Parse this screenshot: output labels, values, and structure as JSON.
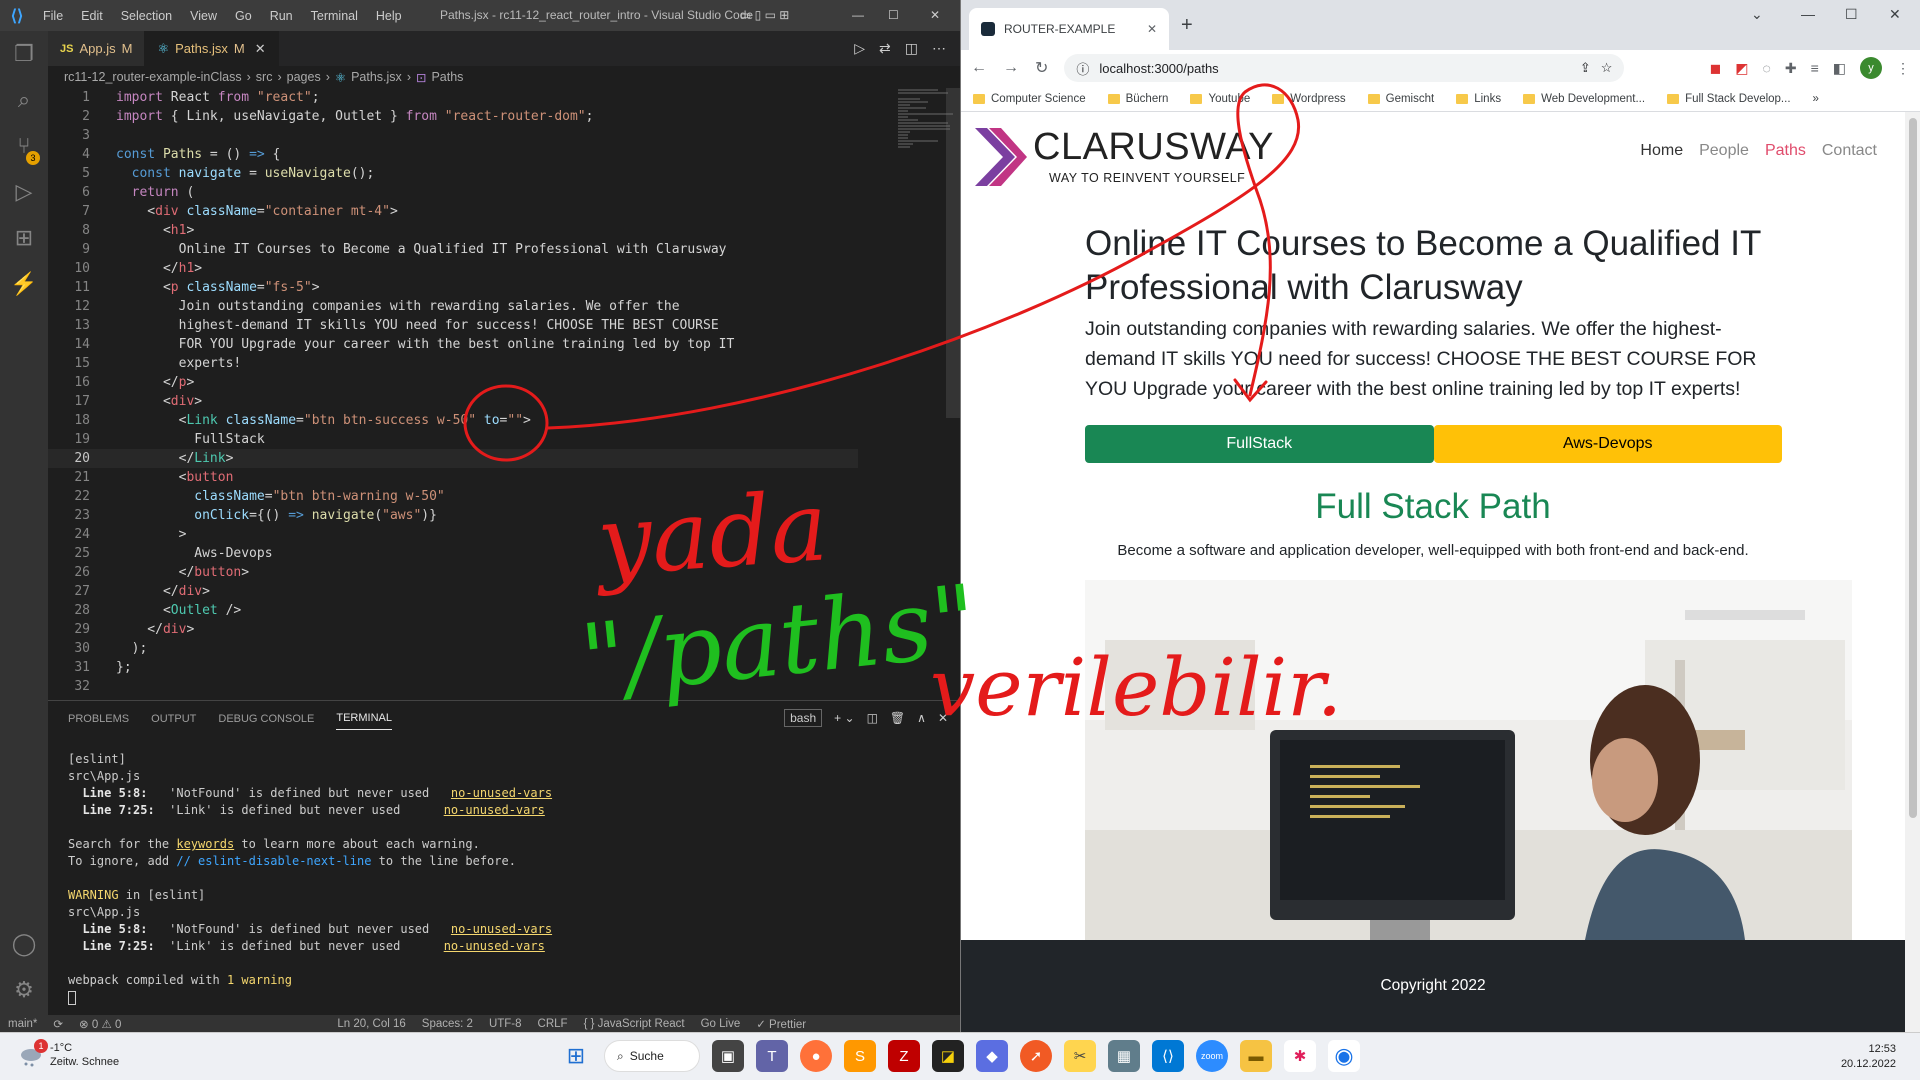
{
  "vscode": {
    "menu": [
      "File",
      "Edit",
      "Selection",
      "View",
      "Go",
      "Run",
      "Terminal",
      "Help"
    ],
    "window_title": "Paths.jsx - rc11-12_react_router_intro - Visual Studio Code",
    "tabs": [
      {
        "badge": "JS",
        "name": "App.js",
        "status": "M"
      },
      {
        "badge": "⚛",
        "name": "Paths.jsx",
        "status": "M"
      }
    ],
    "breadcrumb": [
      "rc11-12_router-example-inClass",
      "src",
      "pages",
      "Paths.jsx",
      "Paths"
    ],
    "panel_tabs": [
      "PROBLEMS",
      "OUTPUT",
      "DEBUG CONSOLE",
      "TERMINAL"
    ],
    "shell": "bash",
    "terminal": {
      "l1": "[eslint]",
      "l2": "src\\App.js",
      "w1_loc": "  Line 5:8:",
      "w1_msg": "   'NotFound' is defined but never used   ",
      "rule": "no-unused-vars",
      "w2_loc": "  Line 7:25:",
      "w2_msg": "  'Link' is defined but never used      ",
      "search_a": "Search for the ",
      "keywords": "keywords",
      "search_b": " to learn more about each warning.",
      "ignore_a": "To ignore, add ",
      "ignore_code": "// eslint-disable-next-line",
      "ignore_b": " to the line before.",
      "warning": "WARNING",
      "warning_rest": " in [eslint]",
      "compiled_a": "webpack compiled with ",
      "compiled_n": "1 warning"
    },
    "status": {
      "branch": "main*",
      "problems": "⊗ 0 ⚠ 0",
      "position": "Ln 20, Col 16",
      "spaces": "Spaces: 2",
      "encoding": "UTF-8",
      "eol": "CRLF",
      "language": "{ } JavaScript React",
      "golive": "Go Live",
      "prettier": "✓ Prettier"
    }
  },
  "code": [
    {
      "n": 1,
      "t": [
        [
          "kw",
          "import "
        ],
        [
          "pun",
          "React "
        ],
        [
          "kw",
          "from "
        ],
        [
          "str",
          "\"react\""
        ],
        [
          "pun",
          ";"
        ]
      ]
    },
    {
      "n": 2,
      "t": [
        [
          "kw",
          "import "
        ],
        [
          "pun",
          "{ Link, useNavigate, Outlet } "
        ],
        [
          "kw",
          "from "
        ],
        [
          "str",
          "\"react-router-dom\""
        ],
        [
          "pun",
          ";"
        ]
      ]
    },
    {
      "n": 3,
      "t": []
    },
    {
      "n": 4,
      "t": [
        [
          "kw2",
          "const "
        ],
        [
          "fn",
          "Paths"
        ],
        [
          "pun",
          " = () "
        ],
        [
          "kw2",
          "=>"
        ],
        [
          "pun",
          " {"
        ]
      ]
    },
    {
      "n": 5,
      "t": [
        [
          "pun",
          "  "
        ],
        [
          "kw2",
          "const "
        ],
        [
          "var",
          "navigate"
        ],
        [
          "pun",
          " = "
        ],
        [
          "fn",
          "useNavigate"
        ],
        [
          "pun",
          "();"
        ]
      ]
    },
    {
      "n": 6,
      "t": [
        [
          "pun",
          "  "
        ],
        [
          "kw",
          "return"
        ],
        [
          "pun",
          " ("
        ]
      ]
    },
    {
      "n": 7,
      "t": [
        [
          "pun",
          "    <"
        ],
        [
          "tagc",
          "div "
        ],
        [
          "attr",
          "className"
        ],
        [
          "pun",
          "="
        ],
        [
          "str",
          "\"container mt-4\""
        ],
        [
          "pun",
          ">"
        ]
      ]
    },
    {
      "n": 8,
      "t": [
        [
          "pun",
          "      <"
        ],
        [
          "tagc",
          "h1"
        ],
        [
          "pun",
          ">"
        ]
      ]
    },
    {
      "n": 9,
      "t": [
        [
          "pun",
          "        Online IT Courses to Become a Qualified IT Professional with Clarusway"
        ]
      ]
    },
    {
      "n": 10,
      "t": [
        [
          "pun",
          "      </"
        ],
        [
          "tagc",
          "h1"
        ],
        [
          "pun",
          ">"
        ]
      ]
    },
    {
      "n": 11,
      "t": [
        [
          "pun",
          "      <"
        ],
        [
          "tagc",
          "p "
        ],
        [
          "attr",
          "className"
        ],
        [
          "pun",
          "="
        ],
        [
          "str",
          "\"fs-5\""
        ],
        [
          "pun",
          ">"
        ]
      ]
    },
    {
      "n": 12,
      "t": [
        [
          "pun",
          "        Join outstanding companies with rewarding salaries. We offer the"
        ]
      ]
    },
    {
      "n": 13,
      "t": [
        [
          "pun",
          "        highest-demand IT skills YOU need for success! CHOOSE THE BEST COURSE"
        ]
      ]
    },
    {
      "n": 14,
      "t": [
        [
          "pun",
          "        FOR YOU Upgrade your career with the best online training led by top IT"
        ]
      ]
    },
    {
      "n": 15,
      "t": [
        [
          "pun",
          "        experts!"
        ]
      ]
    },
    {
      "n": 16,
      "t": [
        [
          "pun",
          "      </"
        ],
        [
          "tagc",
          "p"
        ],
        [
          "pun",
          ">"
        ]
      ]
    },
    {
      "n": 17,
      "t": [
        [
          "pun",
          "      <"
        ],
        [
          "tagc",
          "div"
        ],
        [
          "pun",
          ">"
        ]
      ]
    },
    {
      "n": 18,
      "t": [
        [
          "pun",
          "        <"
        ],
        [
          "cmp",
          "Link "
        ],
        [
          "attr",
          "className"
        ],
        [
          "pun",
          "="
        ],
        [
          "str",
          "\"btn btn-success w-50\" "
        ],
        [
          "attr",
          "to"
        ],
        [
          "pun",
          "="
        ],
        [
          "str",
          "\"\""
        ],
        [
          "pun",
          ">"
        ]
      ]
    },
    {
      "n": 19,
      "t": [
        [
          "pun",
          "          FullStack"
        ]
      ]
    },
    {
      "n": 20,
      "t": [
        [
          "pun",
          "        </"
        ],
        [
          "cmp",
          "Link"
        ],
        [
          "pun",
          ">"
        ]
      ]
    },
    {
      "n": 21,
      "t": [
        [
          "pun",
          "        <"
        ],
        [
          "tagc",
          "button"
        ]
      ]
    },
    {
      "n": 22,
      "t": [
        [
          "pun",
          "          "
        ],
        [
          "attr",
          "className"
        ],
        [
          "pun",
          "="
        ],
        [
          "str",
          "\"btn btn-warning w-50\""
        ]
      ]
    },
    {
      "n": 23,
      "t": [
        [
          "pun",
          "          "
        ],
        [
          "attr",
          "onClick"
        ],
        [
          "pun",
          "={() "
        ],
        [
          "kw2",
          "=>"
        ],
        [
          "pun",
          " "
        ],
        [
          "fn",
          "navigate"
        ],
        [
          "pun",
          "("
        ],
        [
          "str",
          "\"aws\""
        ],
        [
          "pun",
          ")}"
        ]
      ]
    },
    {
      "n": 24,
      "t": [
        [
          "pun",
          "        >"
        ]
      ]
    },
    {
      "n": 25,
      "t": [
        [
          "pun",
          "          Aws-Devops"
        ]
      ]
    },
    {
      "n": 26,
      "t": [
        [
          "pun",
          "        </"
        ],
        [
          "tagc",
          "button"
        ],
        [
          "pun",
          ">"
        ]
      ]
    },
    {
      "n": 27,
      "t": [
        [
          "pun",
          "      </"
        ],
        [
          "tagc",
          "div"
        ],
        [
          "pun",
          ">"
        ]
      ]
    },
    {
      "n": 28,
      "t": [
        [
          "pun",
          "      <"
        ],
        [
          "cmp",
          "Outlet "
        ],
        [
          "pun",
          "/>"
        ]
      ]
    },
    {
      "n": 29,
      "t": [
        [
          "pun",
          "    </"
        ],
        [
          "tagc",
          "div"
        ],
        [
          "pun",
          ">"
        ]
      ]
    },
    {
      "n": 30,
      "t": [
        [
          "pun",
          "  );"
        ]
      ]
    },
    {
      "n": 31,
      "t": [
        [
          "pun",
          "};"
        ]
      ]
    },
    {
      "n": 32,
      "t": []
    }
  ],
  "browser": {
    "tab_title": "ROUTER-EXAMPLE",
    "url": "localhost:3000/paths",
    "bookmarks": [
      "Computer Science",
      "Büchern",
      "Youtube",
      "Wordpress",
      "Gemischt",
      "Links",
      "Web Development...",
      "Full Stack Develop..."
    ],
    "avatar": "y"
  },
  "site": {
    "brand": "CLARUSWAY",
    "tagline": "WAY TO REINVENT YOURSELF",
    "nav": [
      "Home",
      "People",
      "Paths",
      "Contact"
    ],
    "h1": "Online IT Courses to Become a Qualified IT Professional with Clarusway",
    "lead": "Join outstanding companies with rewarding salaries. We offer the highest-demand IT skills YOU need for success! CHOOSE THE BEST COURSE FOR YOU Upgrade your career with the best online training led by top IT experts!",
    "btn_fullstack": "FullStack",
    "btn_aws": "Aws-Devops",
    "path_title": "Full Stack Path",
    "path_desc": "Become a software and application developer, well-equipped with both front-end and back-end.",
    "footer": "Copyright 2022"
  },
  "annotation": {
    "word1": "yada",
    "word2": "\"/paths\"",
    "word3": "verilebilir."
  },
  "taskbar": {
    "temp": "-1°C",
    "weather": "Zeitw. Schnee",
    "weather_badge": "1",
    "search": "Suche",
    "time": "12:53",
    "date": "20.12.2022"
  }
}
